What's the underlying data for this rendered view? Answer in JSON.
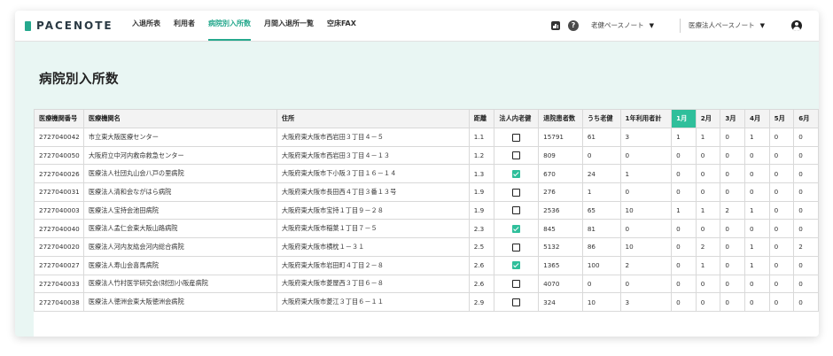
{
  "app": {
    "logo_text": "PACENOTE",
    "nav": [
      {
        "label": "入退所表",
        "active": false
      },
      {
        "label": "利用者",
        "active": false
      },
      {
        "label": "病院別入所数",
        "active": true
      },
      {
        "label": "月間入退所一覧",
        "active": false
      },
      {
        "label": "空床FAX",
        "active": false
      }
    ],
    "header": {
      "dropdown1": "老健ペースノート",
      "dropdown2": "医療法人ペースノート",
      "help_symbol": "?"
    },
    "accent_color": "#25a88d"
  },
  "page": {
    "title": "病院別入所数"
  },
  "table": {
    "headers": [
      "医療機関番号",
      "医療機関名",
      "住所",
      "距離",
      "法人内老健",
      "退院患者数",
      "うち老健",
      "1年利用者計",
      "1月",
      "2月",
      "3月",
      "4月",
      "5月",
      "6月"
    ],
    "active_month_index": 8,
    "rows": [
      {
        "code": "2727040042",
        "name": "市立東大阪医療センター",
        "address": "大阪府東大阪市西岩田３丁目４－５",
        "distance": "1.1",
        "in_corp": false,
        "discharged": "15791",
        "roken": "61",
        "year_total": "3",
        "months": [
          "1",
          "1",
          "0",
          "1",
          "0",
          "0"
        ]
      },
      {
        "code": "2727040050",
        "name": "大阪府立中河内救命救急センター",
        "address": "大阪府東大阪市西岩田３丁目４－１３",
        "distance": "1.2",
        "in_corp": false,
        "discharged": "809",
        "roken": "0",
        "year_total": "0",
        "months": [
          "0",
          "0",
          "0",
          "0",
          "0",
          "0"
        ]
      },
      {
        "code": "2727040026",
        "name": "医療法人社団丸山会八戸の里病院",
        "address": "大阪府東大阪市下小阪３丁目１６－１４",
        "distance": "1.3",
        "in_corp": true,
        "discharged": "670",
        "roken": "24",
        "year_total": "1",
        "months": [
          "0",
          "0",
          "0",
          "0",
          "0",
          "0"
        ]
      },
      {
        "code": "2727040031",
        "name": "医療法人清和会ながはら病院",
        "address": "大阪府東大阪市長田西４丁目３番１３号",
        "distance": "1.9",
        "in_corp": false,
        "discharged": "276",
        "roken": "1",
        "year_total": "0",
        "months": [
          "0",
          "0",
          "0",
          "0",
          "0",
          "0"
        ]
      },
      {
        "code": "2727040003",
        "name": "医療法人宝持会池田病院",
        "address": "大阪府東大阪市宝持１丁目９－２８",
        "distance": "1.9",
        "in_corp": false,
        "discharged": "2536",
        "roken": "65",
        "year_total": "10",
        "months": [
          "1",
          "1",
          "2",
          "1",
          "0",
          "0"
        ]
      },
      {
        "code": "2727040040",
        "name": "医療法人孟仁会東大阪山路病院",
        "address": "大阪府東大阪市稲葉１丁目７－５",
        "distance": "2.3",
        "in_corp": true,
        "discharged": "845",
        "roken": "81",
        "year_total": "0",
        "months": [
          "0",
          "0",
          "0",
          "0",
          "0",
          "0"
        ]
      },
      {
        "code": "2727040020",
        "name": "医療法人河内友紘会河内総合病院",
        "address": "大阪府東大阪市横枕１－３１",
        "distance": "2.5",
        "in_corp": false,
        "discharged": "5132",
        "roken": "86",
        "year_total": "10",
        "months": [
          "0",
          "2",
          "0",
          "1",
          "0",
          "2"
        ]
      },
      {
        "code": "2727040027",
        "name": "医療法人寿山会喜馬病院",
        "address": "大阪府東大阪市岩田町４丁目２－８",
        "distance": "2.6",
        "in_corp": true,
        "discharged": "1365",
        "roken": "100",
        "year_total": "2",
        "months": [
          "0",
          "1",
          "0",
          "1",
          "0",
          "0"
        ]
      },
      {
        "code": "2727040033",
        "name": "医療法人竹村医学研究会(財団)小阪産病院",
        "address": "大阪府東大阪市菱屋西３丁目６－８",
        "distance": "2.6",
        "in_corp": false,
        "discharged": "4070",
        "roken": "0",
        "year_total": "0",
        "months": [
          "0",
          "0",
          "0",
          "0",
          "0",
          "0"
        ]
      },
      {
        "code": "2727040038",
        "name": "医療法人徳洲会東大阪徳洲会病院",
        "address": "大阪府東大阪市菱江３丁目６－１１",
        "distance": "2.9",
        "in_corp": false,
        "discharged": "324",
        "roken": "10",
        "year_total": "3",
        "months": [
          "0",
          "0",
          "0",
          "0",
          "0",
          "0"
        ]
      }
    ]
  }
}
